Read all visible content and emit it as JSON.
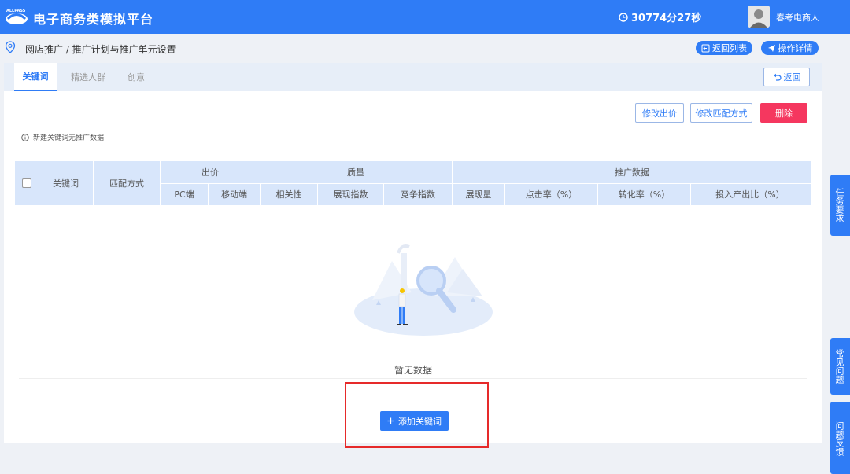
{
  "header": {
    "logo_text": "ALLPASS",
    "title": "电子商务类模拟平台",
    "timer": "30774分27秒",
    "username": "春考电商人",
    "colors": {
      "primary": "#2f7cf6",
      "danger": "#f5375f"
    }
  },
  "breadcrumb": {
    "text": "网店推广 / 推广计划与推广单元设置",
    "icon": "location-pin-icon"
  },
  "top_actions": {
    "back_to_list": "返回列表",
    "operation_details": "操作详情"
  },
  "tabs": [
    {
      "label": "关键词",
      "active": true
    },
    {
      "label": "精选人群",
      "active": false
    },
    {
      "label": "创意",
      "active": false
    }
  ],
  "back_button": "返回",
  "toolbar": {
    "modify_bid": "修改出价",
    "modify_match": "修改匹配方式",
    "delete": "删除"
  },
  "notice": "新建关键词无推广数据",
  "table": {
    "keyword": "关键词",
    "match_type": "匹配方式",
    "bid_group": "出价",
    "bid_cols": [
      "PC端",
      "移动端"
    ],
    "quality_group": "质量",
    "quality_cols": [
      "相关性",
      "展现指数",
      "竞争指数"
    ],
    "promo_group": "推广数据",
    "promo_cols": [
      "展现量",
      "点击率（%）",
      "转化率（%）",
      "投入产出比（%）"
    ]
  },
  "empty_text": "暂无数据",
  "add_keyword_button": "添加关键词",
  "side_tabs": {
    "task": "任务要求",
    "faq": "常见问题",
    "feedback": "问题反馈"
  }
}
